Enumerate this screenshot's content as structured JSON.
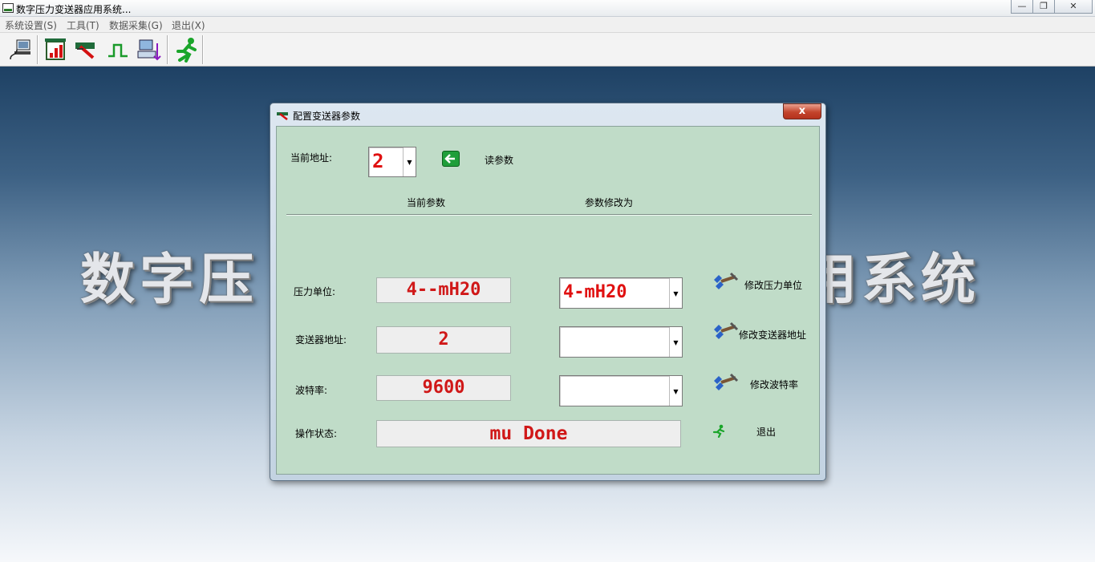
{
  "window": {
    "title": "数字压力变送器应用系统...",
    "min": "—",
    "restore": "❐",
    "close": "✕"
  },
  "menu": [
    "系统设置(S)",
    "工具(T)",
    "数据采集(G)",
    "退出(X)"
  ],
  "toolbar": [
    "port-settings-icon",
    "chart-icon",
    "transmitter-config-icon",
    "pulse-icon",
    "data-collect-icon",
    "exit-runner-icon"
  ],
  "background": {
    "text_left": "数字压",
    "text_right": "用系统"
  },
  "dialog": {
    "title": "配置变送器参数",
    "close": "x",
    "address_label": "当前地址:",
    "address_value": "2",
    "read_button": "读参数",
    "col_current": "当前参数",
    "col_modify": "参数修改为",
    "rows": [
      {
        "label": "压力单位:",
        "current": "4--mH20",
        "new_value": "4-mH20",
        "action": "修改压力单位"
      },
      {
        "label": "变送器地址:",
        "current": "2",
        "new_value": "",
        "action": "修改变送器地址"
      },
      {
        "label": "波特率:",
        "current": "9600",
        "new_value": "",
        "action": "修改波特率"
      }
    ],
    "status_label": "操作状态:",
    "status_value": "mu Done",
    "exit_label": "退出"
  },
  "colors": {
    "panel": "#c0dcc8",
    "value_red": "#d01818",
    "close_red": "#c3442c",
    "desktop_top": "#1e4164"
  }
}
